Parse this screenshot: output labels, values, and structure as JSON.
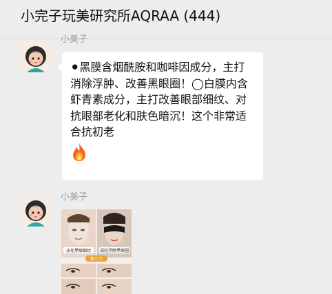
{
  "header": {
    "title": "小完子玩美研究所AQRAA (444)"
  },
  "messages": [
    {
      "sender": "小美子",
      "text": "⚫黑膜含烟酰胺和咖啡因成分，主打消除浮肿、改善黑眼圈！◯白膜内含虾青素成分，主打改善眼部细纹、对抗眼部老化和肤色暗沉！这个非常适合抗初老",
      "emoji": "fire-icon"
    },
    {
      "sender": "小美子",
      "image": {
        "left_caption": "淡化黑眼细纹",
        "right_caption": "减轻浮肿黑眼圈",
        "badge": "第二个"
      }
    }
  ],
  "colors": {
    "background": "#ededed",
    "bubble": "#ffffff",
    "sender_name": "#9a9a9a"
  }
}
